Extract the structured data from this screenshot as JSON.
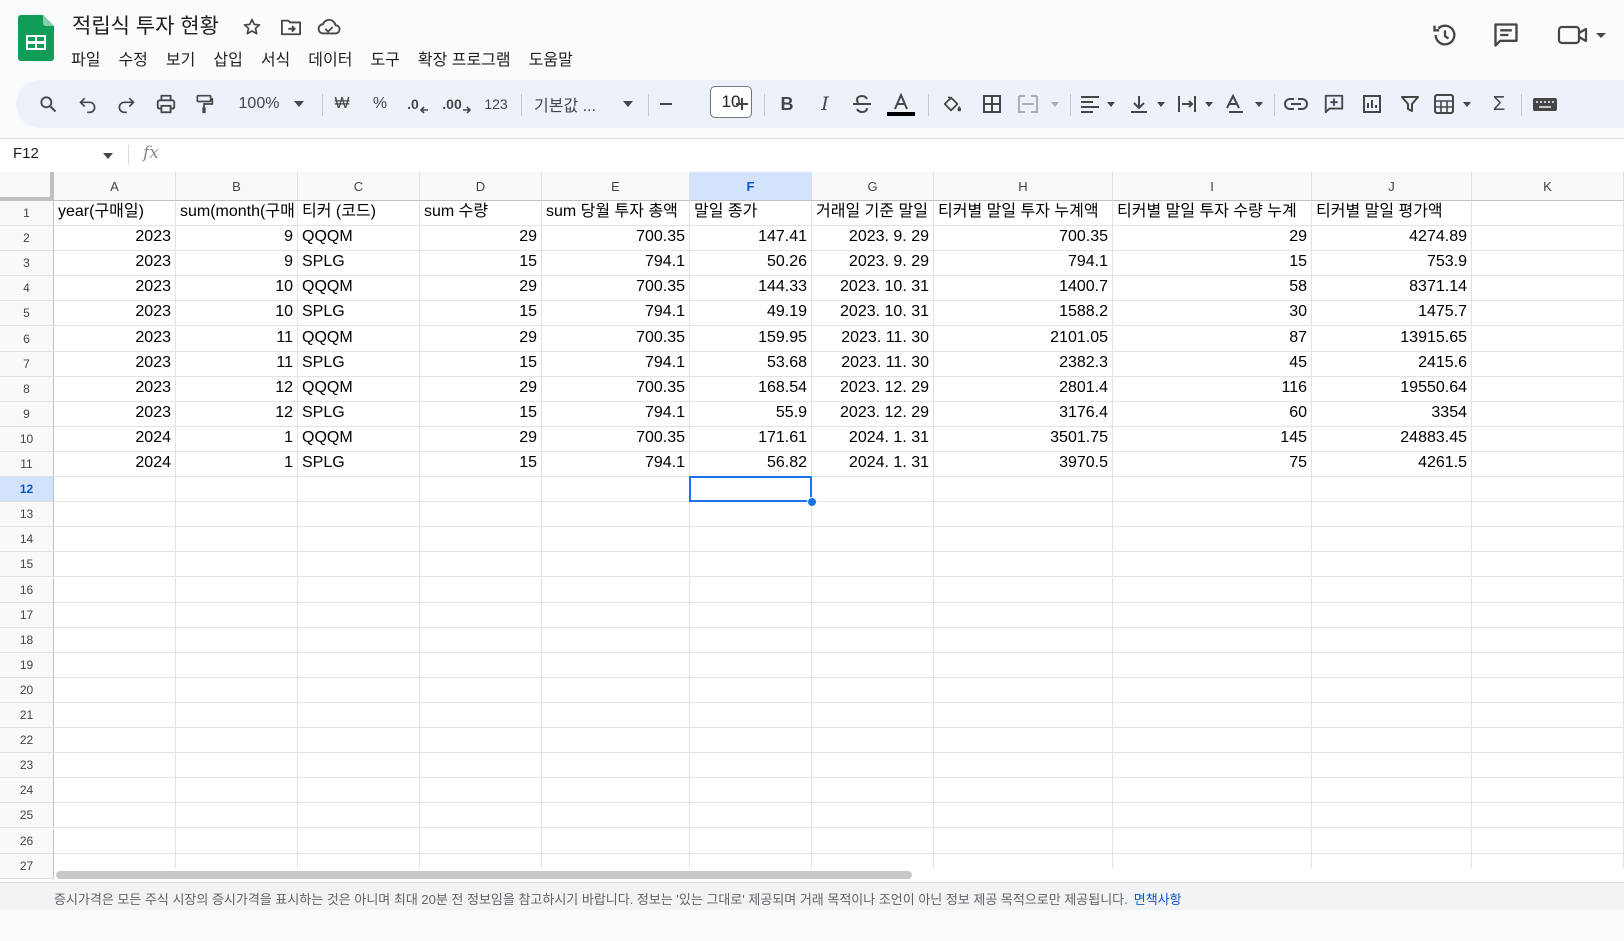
{
  "app": {
    "title": "적립식 투자 현황",
    "menu": [
      "파일",
      "수정",
      "보기",
      "삽입",
      "서식",
      "데이터",
      "도구",
      "확장 프로그램",
      "도움말"
    ]
  },
  "toolbar": {
    "zoom": "100%",
    "currency": "₩",
    "percent": "%",
    "dec_decrease": ".0",
    "dec_increase": ".00",
    "number_format": "123",
    "font": "기본값 ...",
    "font_size": "10"
  },
  "formula_bar": {
    "cell_ref": "F12",
    "fx": "fx",
    "value": ""
  },
  "sheet": {
    "columns": [
      "A",
      "B",
      "C",
      "D",
      "E",
      "F",
      "G",
      "H",
      "I",
      "J",
      "K"
    ],
    "selected_column": "F",
    "selected_row": "12",
    "rows": [
      "1",
      "2",
      "3",
      "4",
      "5",
      "6",
      "7",
      "8",
      "9",
      "10",
      "11",
      "12",
      "13",
      "14",
      "15",
      "16",
      "17",
      "18",
      "19",
      "20",
      "21",
      "22",
      "23",
      "24",
      "25",
      "26",
      "27"
    ],
    "headers": [
      "year(구매일)",
      "sum(month(구매",
      "티커 (코드)",
      "sum 수량",
      "sum 당월 투자 총액",
      "말일 종가",
      "거래일 기준 말일",
      "티커별 말일 투자 누계액",
      "티커별 말일 투자 수량 누계",
      "티커별 말일 평가액",
      ""
    ],
    "data": [
      [
        "2023",
        "9",
        "QQQM",
        "29",
        "700.35",
        "147.41",
        "2023. 9. 29",
        "700.35",
        "29",
        "4274.89"
      ],
      [
        "2023",
        "9",
        "SPLG",
        "15",
        "794.1",
        "50.26",
        "2023. 9. 29",
        "794.1",
        "15",
        "753.9"
      ],
      [
        "2023",
        "10",
        "QQQM",
        "29",
        "700.35",
        "144.33",
        "2023. 10. 31",
        "1400.7",
        "58",
        "8371.14"
      ],
      [
        "2023",
        "10",
        "SPLG",
        "15",
        "794.1",
        "49.19",
        "2023. 10. 31",
        "1588.2",
        "30",
        "1475.7"
      ],
      [
        "2023",
        "11",
        "QQQM",
        "29",
        "700.35",
        "159.95",
        "2023. 11. 30",
        "2101.05",
        "87",
        "13915.65"
      ],
      [
        "2023",
        "11",
        "SPLG",
        "15",
        "794.1",
        "53.68",
        "2023. 11. 30",
        "2382.3",
        "45",
        "2415.6"
      ],
      [
        "2023",
        "12",
        "QQQM",
        "29",
        "700.35",
        "168.54",
        "2023. 12. 29",
        "2801.4",
        "116",
        "19550.64"
      ],
      [
        "2023",
        "12",
        "SPLG",
        "15",
        "794.1",
        "55.9",
        "2023. 12. 29",
        "3176.4",
        "60",
        "3354"
      ],
      [
        "2024",
        "1",
        "QQQM",
        "29",
        "700.35",
        "171.61",
        "2024. 1. 31",
        "3501.75",
        "145",
        "24883.45"
      ],
      [
        "2024",
        "1",
        "SPLG",
        "15",
        "794.1",
        "56.82",
        "2024. 1. 31",
        "3970.5",
        "75",
        "4261.5"
      ]
    ]
  },
  "footer": {
    "text": "증시가격은 모든 주식 시장의 증시가격을 표시하는 것은 아니며 최대 20분 전 정보임을 참고하시기 바랍니다. 정보는 '있는 그대로' 제공되며 거래 목적이나 조언이 아닌 정보 제공 목적으로만 제공됩니다.",
    "link": "면책사항"
  },
  "icons": [
    "sheets-logo-icon",
    "star-icon",
    "move-folder-icon",
    "cloud-saved-icon",
    "history-icon",
    "comment-icon",
    "meet-icon",
    "search-icon",
    "undo-icon",
    "redo-icon",
    "print-icon",
    "paint-format-icon",
    "bold-icon",
    "italic-icon",
    "strikethrough-icon",
    "text-color-icon",
    "fill-color-icon",
    "borders-icon",
    "merge-icon",
    "align-left-icon",
    "valign-bottom-icon",
    "text-wrap-icon",
    "text-rotation-icon",
    "link-icon",
    "insert-comment-icon",
    "insert-chart-icon",
    "filter-icon",
    "filter-views-icon",
    "functions-icon",
    "keyboard-icon"
  ],
  "colors": {
    "accent": "#0b57d0",
    "sheets_green": "#0f9d58",
    "selection": "#1a73e8",
    "selected_header": "#d3e3fd"
  }
}
